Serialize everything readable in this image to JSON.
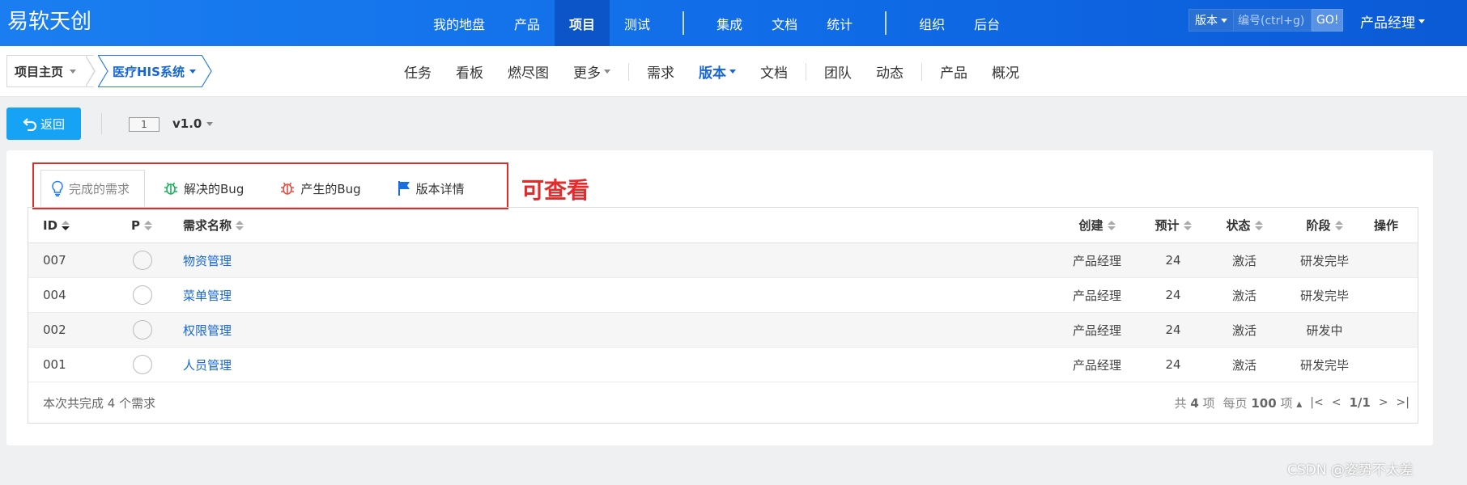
{
  "topbar": {
    "logo": "易软天创",
    "nav_groups": [
      [
        "我的地盘",
        "产品",
        "项目",
        "测试"
      ],
      [
        "集成",
        "文档",
        "统计"
      ],
      [
        "组织",
        "后台"
      ]
    ],
    "active_nav": "项目",
    "search": {
      "select_label": "版本",
      "placeholder": "编号(ctrl+g)",
      "go_label": "GO!"
    },
    "user": "产品经理"
  },
  "subbar": {
    "breadcrumb_home": "项目主页",
    "breadcrumb_project": "医疗HIS系统",
    "items": [
      {
        "label": "任务"
      },
      {
        "label": "看板"
      },
      {
        "label": "燃尽图"
      },
      {
        "label": "更多",
        "dropdown": true
      },
      {
        "sep": true
      },
      {
        "label": "需求"
      },
      {
        "label": "版本",
        "dropdown": true,
        "active": true
      },
      {
        "label": "文档"
      },
      {
        "sep": true
      },
      {
        "label": "团队"
      },
      {
        "label": "动态"
      },
      {
        "sep": true
      },
      {
        "label": "产品"
      },
      {
        "label": "概况"
      }
    ]
  },
  "toolbar": {
    "back_label": "返回",
    "version_badge": "1",
    "version_name": "v1.0"
  },
  "tabs": [
    {
      "label": "完成的需求",
      "icon": "lightbulb-icon",
      "active": true
    },
    {
      "label": "解决的Bug",
      "icon": "bug-green-icon"
    },
    {
      "label": "产生的Bug",
      "icon": "bug-red-icon"
    },
    {
      "label": "版本详情",
      "icon": "flag-icon"
    }
  ],
  "annotation": "可查看",
  "table": {
    "headers": {
      "id": "ID",
      "p": "P",
      "name": "需求名称",
      "creator": "创建",
      "estimate": "预计",
      "status": "状态",
      "stage": "阶段",
      "op": "操作"
    },
    "rows": [
      {
        "id": "007",
        "name": "物资管理",
        "creator": "产品经理",
        "estimate": "24",
        "status": "激活",
        "stage": "研发完毕"
      },
      {
        "id": "004",
        "name": "菜单管理",
        "creator": "产品经理",
        "estimate": "24",
        "status": "激活",
        "stage": "研发完毕"
      },
      {
        "id": "002",
        "name": "权限管理",
        "creator": "产品经理",
        "estimate": "24",
        "status": "激活",
        "stage": "研发中"
      },
      {
        "id": "001",
        "name": "人员管理",
        "creator": "产品经理",
        "estimate": "24",
        "status": "激活",
        "stage": "研发完毕"
      }
    ],
    "summary": "本次共完成 4 个需求",
    "pager": {
      "total_prefix": "共",
      "total": "4",
      "total_suffix": "项",
      "per_page_prefix": "每页",
      "per_page": "100",
      "per_page_suffix": "项",
      "page": "1/1"
    }
  },
  "watermark": "CSDN @姿势不太差",
  "colors": {
    "topbar": "#1a7ef0",
    "accent": "#1666d8",
    "back_button": "#17a3f5",
    "annotation": "#e12c2c"
  }
}
